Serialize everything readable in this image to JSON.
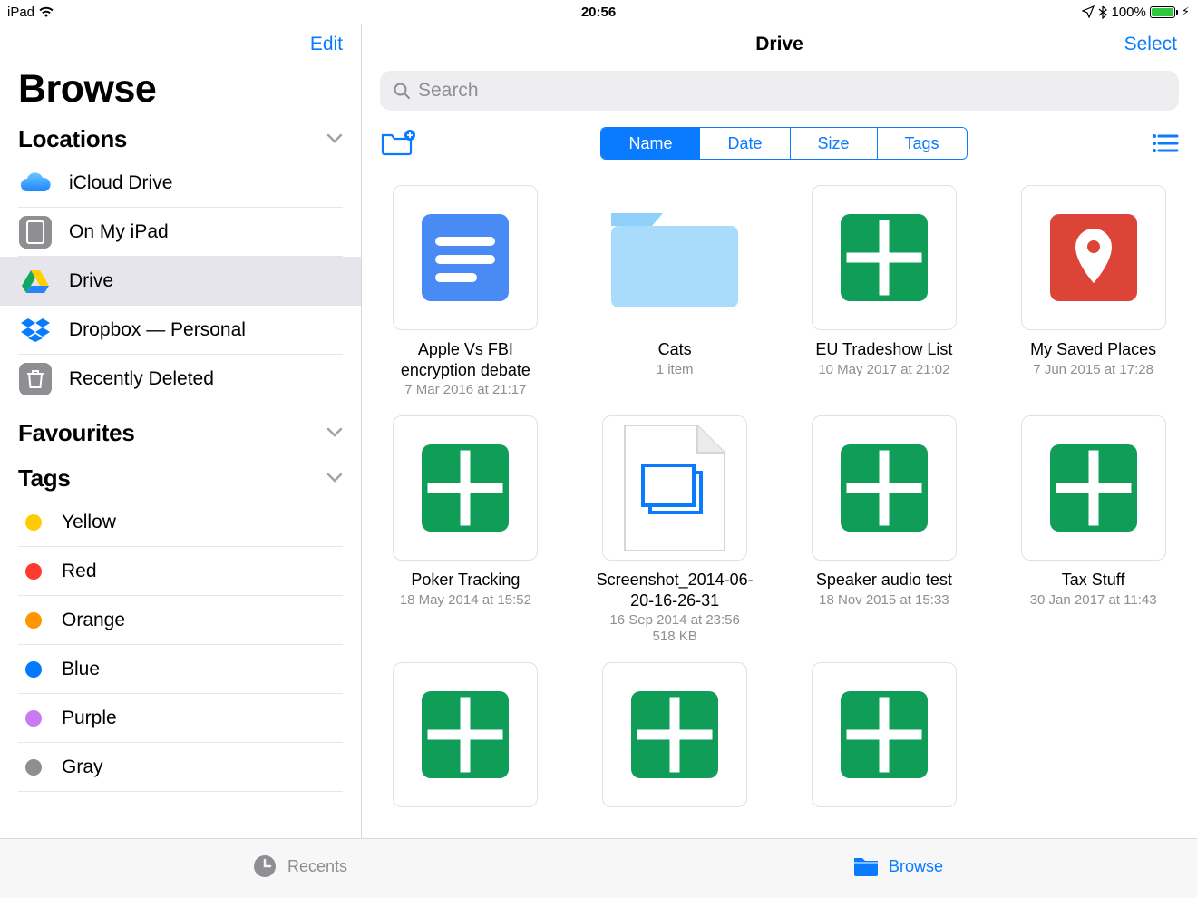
{
  "status": {
    "device": "iPad",
    "time": "20:56",
    "battery": "100%"
  },
  "sidebar": {
    "edit": "Edit",
    "title": "Browse",
    "sections": {
      "locations": {
        "label": "Locations"
      },
      "favourites": {
        "label": "Favourites"
      },
      "tags": {
        "label": "Tags"
      }
    },
    "locations": [
      {
        "label": "iCloud Drive",
        "icon": "icloud"
      },
      {
        "label": "On My iPad",
        "icon": "ipad"
      },
      {
        "label": "Drive",
        "icon": "gdrive",
        "selected": true
      },
      {
        "label": "Dropbox — Personal",
        "icon": "dropbox"
      },
      {
        "label": "Recently Deleted",
        "icon": "trash"
      }
    ],
    "tags": [
      {
        "label": "Yellow",
        "color": "#ffcc02"
      },
      {
        "label": "Red",
        "color": "#ff3b30"
      },
      {
        "label": "Orange",
        "color": "#ff9500"
      },
      {
        "label": "Blue",
        "color": "#007aff"
      },
      {
        "label": "Purple",
        "color": "#c77cf4"
      },
      {
        "label": "Gray",
        "color": "#8e8e93"
      }
    ]
  },
  "main": {
    "title": "Drive",
    "select": "Select",
    "search_placeholder": "Search",
    "sort": {
      "options": [
        "Name",
        "Date",
        "Size",
        "Tags"
      ],
      "active": "Name"
    }
  },
  "files": [
    {
      "name": "Apple Vs FBI encryption debate",
      "meta": "7 Mar 2016 at 21:17",
      "icon": "gdoc"
    },
    {
      "name": "Cats",
      "meta": "1 item",
      "icon": "folder"
    },
    {
      "name": "EU Tradeshow List",
      "meta": "10 May 2017 at 21:02",
      "icon": "gsheet"
    },
    {
      "name": "My Saved Places",
      "meta": "7 Jun 2015 at 17:28",
      "icon": "gmap"
    },
    {
      "name": "Poker Tracking",
      "meta": "18 May 2014 at 15:52",
      "icon": "gsheet"
    },
    {
      "name": "Screenshot_2014-06-20-16-26-31",
      "meta": "16 Sep 2014 at 23:56",
      "meta2": "518 KB",
      "icon": "image"
    },
    {
      "name": "Speaker audio test",
      "meta": "18 Nov 2015 at 15:33",
      "icon": "gsheet"
    },
    {
      "name": "Tax Stuff",
      "meta": "30 Jan 2017 at 11:43",
      "icon": "gsheet"
    },
    {
      "name": "",
      "meta": "",
      "icon": "gsheet"
    },
    {
      "name": "",
      "meta": "",
      "icon": "gsheet"
    },
    {
      "name": "",
      "meta": "",
      "icon": "gsheet"
    }
  ],
  "tabbar": {
    "recents": "Recents",
    "browse": "Browse"
  }
}
